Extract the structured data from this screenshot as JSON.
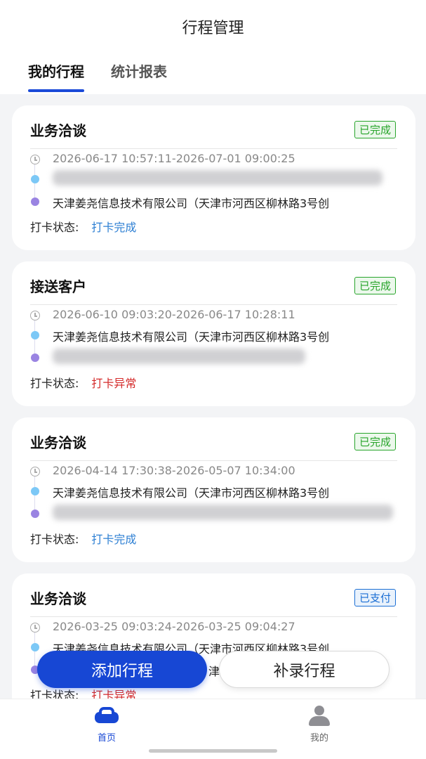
{
  "header": {
    "title": "行程管理",
    "tabs": [
      {
        "label": "我的行程",
        "active": true
      },
      {
        "label": "统计报表",
        "active": false
      }
    ]
  },
  "status_label": "打卡状态:",
  "trips": [
    {
      "type": "业务洽谈",
      "badge": "已完成",
      "time": "2026-06-17 10:57:11-2026-07-01 09:00:25",
      "start": "",
      "end": "天津姜尧信息技术有限公司（天津市河西区柳林路3号创",
      "check_status": "打卡完成"
    },
    {
      "type": "接送客户",
      "badge": "已完成",
      "time": "2026-06-10 09:03:20-2026-06-17 10:28:11",
      "start": "天津姜尧信息技术有限公司（天津市河西区柳林路3号创",
      "end": "",
      "check_status": "打卡异常"
    },
    {
      "type": "业务洽谈",
      "badge": "已完成",
      "time": "2026-04-14 17:30:38-2026-05-07 10:34:00",
      "start": "天津姜尧信息技术有限公司（天津市河西区柳林路3号创",
      "end": "",
      "check_status": "打卡完成"
    },
    {
      "type": "业务洽谈",
      "badge": "已支付",
      "time": "2026-03-25 09:03:24-2026-03-25 09:04:27",
      "start": "天津姜尧信息技术有限公司（天津市河西区柳林路3号创",
      "end": "津",
      "check_status": "打卡异常"
    }
  ],
  "actions": {
    "add": "添加行程",
    "supplement": "补录行程"
  },
  "nav": {
    "home": "首页",
    "me": "我的"
  },
  "colors": {
    "primary": "#1747d4",
    "done": "#29a52c",
    "paid": "#1c6fd4",
    "ok": "#2d7fd3",
    "bad": "#d42a2a"
  }
}
